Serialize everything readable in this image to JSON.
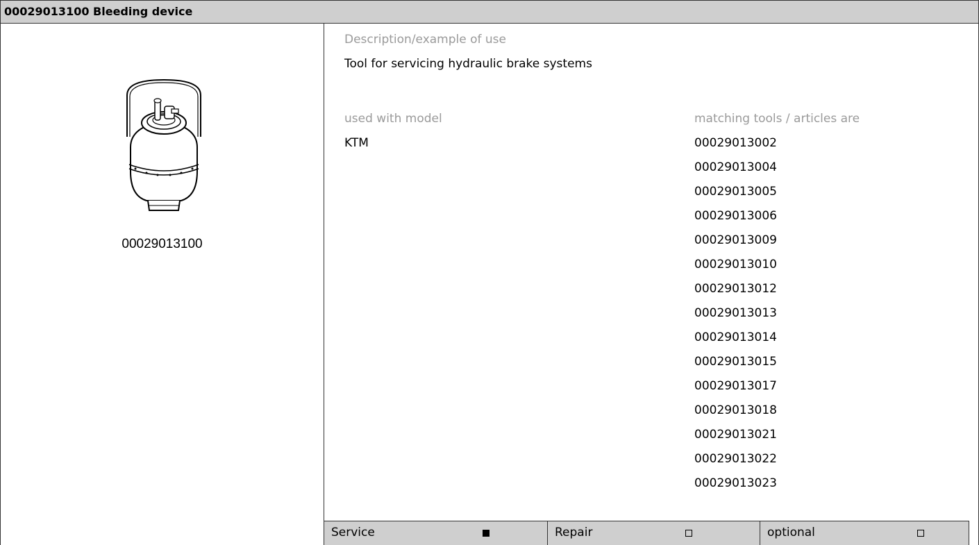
{
  "header": {
    "title": "00029013100 Bleeding device"
  },
  "tool": {
    "image_icon": "bleeding-device-drawing",
    "number": "00029013100"
  },
  "description": {
    "label": "Description/example of use",
    "text": "Tool for servicing hydraulic brake systems"
  },
  "model": {
    "label": "used with model",
    "value": "KTM"
  },
  "matching": {
    "label": "matching tools / articles are",
    "items": [
      "00029013002",
      "00029013004",
      "00029013005",
      "00029013006",
      "00029013009",
      "00029013010",
      "00029013012",
      "00029013013",
      "00029013014",
      "00029013015",
      "00029013017",
      "00029013018",
      "00029013021",
      "00029013022",
      "00029013023"
    ]
  },
  "footer": {
    "service_label": "Service",
    "service_checked": true,
    "repair_label": "Repair",
    "repair_checked": false,
    "optional_label": "optional",
    "optional_checked": false
  }
}
